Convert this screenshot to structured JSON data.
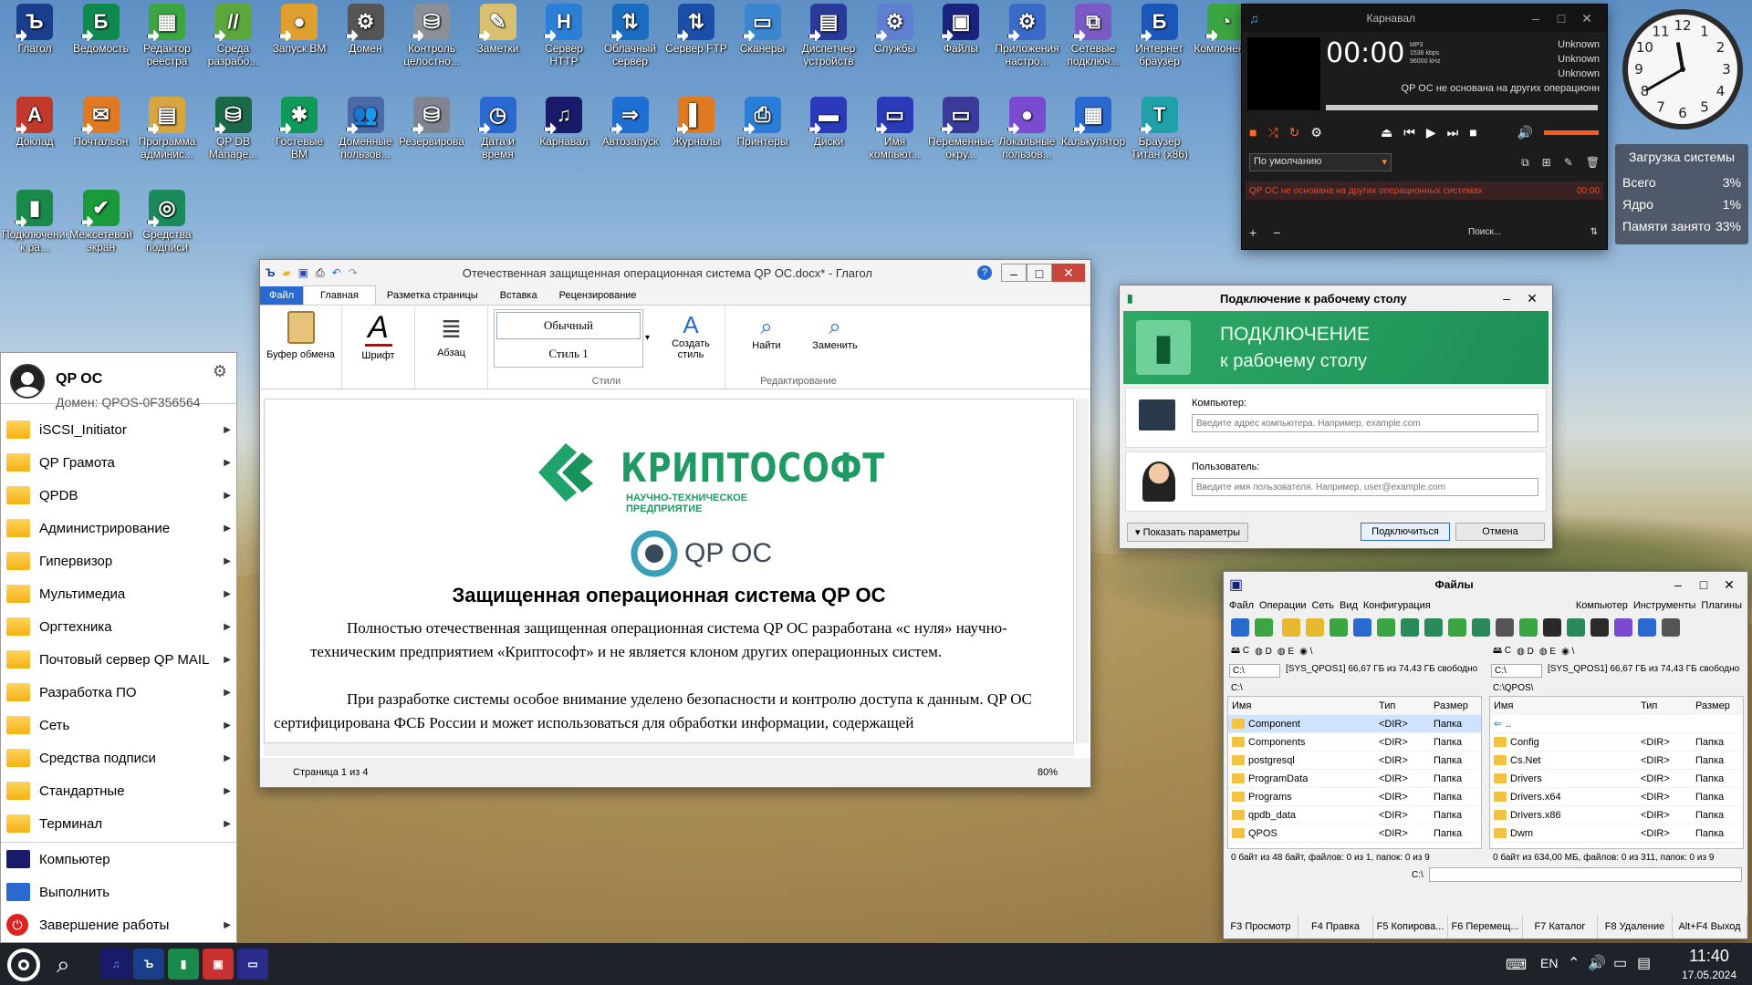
{
  "desktop_icons": [
    {
      "label": "Глагол",
      "color": "#1a3e8c",
      "glyph": "Ъ"
    },
    {
      "label": "Ведомость",
      "color": "#0f8a4e",
      "glyph": "Б"
    },
    {
      "label": "Редактор реестра",
      "color": "#3aa541",
      "glyph": "▦"
    },
    {
      "label": "Среда разрабо...",
      "color": "#5aa83b",
      "glyph": "//"
    },
    {
      "label": "Запуск ВМ",
      "color": "#e0a030",
      "glyph": "●"
    },
    {
      "label": "Домен",
      "color": "#555",
      "glyph": "⚙"
    },
    {
      "label": "Контроль целостно...",
      "color": "#8b8f99",
      "glyph": "⛁"
    },
    {
      "label": "Заметки",
      "color": "#d8c070",
      "glyph": "✎"
    },
    {
      "label": "Сервер HTTP",
      "color": "#2c7fd6",
      "glyph": "H"
    },
    {
      "label": "Облачный сервер",
      "color": "#1a6dc0",
      "glyph": "⇅"
    },
    {
      "label": "Сервер FTP",
      "color": "#1a4ea8",
      "glyph": "⇅"
    },
    {
      "label": "Сканеры",
      "color": "#3a87d0",
      "glyph": "▭"
    },
    {
      "label": "Диспетчер устройств",
      "color": "#2a3a9a",
      "glyph": "▤"
    },
    {
      "label": "Службы",
      "color": "#5f7fd0",
      "glyph": "⚙"
    },
    {
      "label": "Файлы",
      "color": "#1a237e",
      "glyph": "▣"
    },
    {
      "label": "Приложения настро...",
      "color": "#3a6ac8",
      "glyph": "⚙"
    },
    {
      "label": "Сетевые подключ...",
      "color": "#7c5ac6",
      "glyph": "⧉"
    },
    {
      "label": "Интернет браузер",
      "color": "#1a57b8",
      "glyph": "Б"
    },
    {
      "label": "Компоненты",
      "color": "#3aa541",
      "glyph": "◔"
    },
    {
      "label": "Доклад",
      "color": "#c0392b",
      "glyph": "A"
    },
    {
      "label": "Почтальон",
      "color": "#e07a22",
      "glyph": "✉"
    },
    {
      "label": "Программа админис...",
      "color": "#d7a640",
      "glyph": "▤"
    },
    {
      "label": "QP DB Manage...",
      "color": "#1a6a4a",
      "glyph": "⛁"
    },
    {
      "label": "Гостевые ВМ",
      "color": "#0f9a5a",
      "glyph": "✱"
    },
    {
      "label": "Доменные пользов...",
      "color": "#4a6aa8",
      "glyph": "👥"
    },
    {
      "label": "Резервирование",
      "color": "#7e8491",
      "glyph": "⛁"
    },
    {
      "label": "Дата и время",
      "color": "#2a6ad0",
      "glyph": "◷"
    },
    {
      "label": "Карнавал",
      "color": "#1a1a6a",
      "glyph": "♫"
    },
    {
      "label": "Автозапуск",
      "color": "#1f6fd2",
      "glyph": "⇒"
    },
    {
      "label": "Журналы",
      "color": "#e07a22",
      "glyph": "▌"
    },
    {
      "label": "Принтеры",
      "color": "#2a7ed8",
      "glyph": "⎙"
    },
    {
      "label": "Диски",
      "color": "#2a3ab8",
      "glyph": "▬"
    },
    {
      "label": "Имя компьют...",
      "color": "#2a3ab8",
      "glyph": "▭"
    },
    {
      "label": "Переменные окру...",
      "color": "#3a3a9a",
      "glyph": "▭"
    },
    {
      "label": "Локальные пользов...",
      "color": "#7a4ad0",
      "glyph": "●"
    },
    {
      "label": "Калькулятор",
      "color": "#2a6ad0",
      "glyph": "▦"
    },
    {
      "label": "Браузер Титан (x86)",
      "color": "#20a0a8",
      "glyph": "T"
    },
    {
      "label": "Подключение к ра...",
      "color": "#1a8a4a",
      "glyph": "▮"
    },
    {
      "label": "Межсетевой экран",
      "color": "#1a9a3a",
      "glyph": "✔"
    },
    {
      "label": "Средства подписи",
      "color": "#1a8a5a",
      "glyph": "◎"
    }
  ],
  "media_player": {
    "title": "Карнавал",
    "time": "00:00",
    "format": "MP3",
    "bitrate": "1536 kbps",
    "samplerate": "96000 kHz",
    "meta": [
      "Unknown",
      "Unknown",
      "Unknown"
    ],
    "track": "QP ОС не основана на других операционн",
    "preset": "По умолчанию",
    "playlist_item": "QP ОС не основана на других операционных системах",
    "playlist_time": "00:00",
    "add": "+",
    "remove": "−",
    "search": "Поиск..."
  },
  "clock_gadget": {
    "hour": 11,
    "minute": 40
  },
  "sysload": {
    "title": "Загрузка системы",
    "rows": [
      {
        "k": "Всего",
        "v": "3%"
      },
      {
        "k": "Ядро",
        "v": "1%"
      },
      {
        "k": "Памяти занято",
        "v": "33%"
      }
    ]
  },
  "writer": {
    "title": "Отечественная защищенная операционная система QP OC.docx* - Глагол",
    "tabs": [
      "Файл",
      "Главная",
      "Разметка страницы",
      "Вставка",
      "Рецензирование"
    ],
    "groups": {
      "clipboard": "Буфер обмена",
      "font": "Шрифт",
      "paragraph": "Абзац",
      "style1": "Обычный",
      "style2": "Стиль 1",
      "create_style": "Создать стиль",
      "styles": "Стили",
      "find": "Найти",
      "replace": "Заменить",
      "editing": "Редактирование"
    },
    "logo_main": "КРИПТОСОФТ",
    "logo_sub": "НАУЧНО-ТЕХНИЧЕСКОЕ ПРЕДПРИЯТИЕ",
    "logo_qp": "QP OC",
    "heading": "Защищенная операционная система QP OC",
    "p1": "Полностью отечественная защищенная операционная система QP OC разработана «с нуля» научно-техническим предприятием «Криптософт» и не является клоном других операционных систем.",
    "p2": "При разработке системы особое внимание уделено безопасности и контролю доступа к данным. QP OC сертифицирована ФСБ России и может использоваться для обработки информации, содержащей",
    "status_page": "Страница 1 из 4",
    "zoom": "80%"
  },
  "rdp": {
    "title": "Подключение к рабочему столу",
    "banner1": "ПОДКЛЮЧЕНИЕ",
    "banner2": "к рабочему столу",
    "computer_label": "Компьютер:",
    "computer_ph": "Введите адрес компьютера. Например, example.com",
    "user_label": "Пользователь:",
    "user_ph": "Введите имя пользователя. Например, user@example.com",
    "show_params": "Показать параметры",
    "connect": "Подключиться",
    "cancel": "Отмена"
  },
  "start_menu": {
    "user": "QP OC",
    "domain": "Домен: QPOS-0F356564",
    "items": [
      "iSCSI_Initiator",
      "QP Грамота",
      "QPDB",
      "Администрирование",
      "Гипервизор",
      "Мультимедиа",
      "Оргтехника",
      "Почтовый сервер QP MAIL",
      "Разработка ПО",
      "Сеть",
      "Средства подписи",
      "Стандартные",
      "Терминал"
    ],
    "bottom": [
      "Компьютер",
      "Выполнить",
      "Завершение работы"
    ]
  },
  "files": {
    "title": "Файлы",
    "menu": [
      "Файл",
      "Операции",
      "Сеть",
      "Вид",
      "Конфигурация"
    ],
    "menu_right": [
      "Компьютер",
      "Инструменты",
      "Плагины"
    ],
    "drives": [
      "C",
      "D",
      "E",
      "\\"
    ],
    "left": {
      "drive": "C:\\",
      "info": "[SYS_QPOS1] 66,67 ГБ из 74,43 ГБ свободно",
      "path": "C:\\",
      "cols": [
        "Имя",
        "Тип",
        "Размер"
      ],
      "rows": [
        [
          "Component",
          "<DIR>",
          "Папка"
        ],
        [
          "Components",
          "<DIR>",
          "Папка"
        ],
        [
          "postgresql",
          "<DIR>",
          "Папка"
        ],
        [
          "ProgramData",
          "<DIR>",
          "Папка"
        ],
        [
          "Programs",
          "<DIR>",
          "Папка"
        ],
        [
          "qpdb_data",
          "<DIR>",
          "Папка"
        ],
        [
          "QPOS",
          "<DIR>",
          "Папка"
        ]
      ],
      "status": "0 байт из 48 байт, файлов: 0 из 1, папок: 0 из 9"
    },
    "right": {
      "drive": "C:\\",
      "info": "[SYS_QPOS1] 66,67 ГБ из 74,43 ГБ свободно",
      "path": "C:\\QPOS\\",
      "cols": [
        "Имя",
        "Тип",
        "Размер"
      ],
      "rows": [
        [
          "..",
          "",
          ""
        ],
        [
          "Config",
          "<DIR>",
          "Папка"
        ],
        [
          "Cs.Net",
          "<DIR>",
          "Папка"
        ],
        [
          "Drivers",
          "<DIR>",
          "Папка"
        ],
        [
          "Drivers.x64",
          "<DIR>",
          "Папка"
        ],
        [
          "Drivers.x86",
          "<DIR>",
          "Папка"
        ],
        [
          "Dwm",
          "<DIR>",
          "Папка"
        ]
      ],
      "status": "0 байт из 634,00 МБ, файлов: 0 из 311, папок: 0 из 9"
    },
    "cmd_path": "C:\\",
    "fkeys": [
      "F3 Просмотр",
      "F4 Правка",
      "F5 Копирова...",
      "F6 Перемещ...",
      "F7 Каталог",
      "F8 Удаление",
      "Alt+F4 Выход"
    ]
  },
  "taskbar": {
    "lang": "EN",
    "time": "11:40",
    "date": "17.05.2024"
  }
}
